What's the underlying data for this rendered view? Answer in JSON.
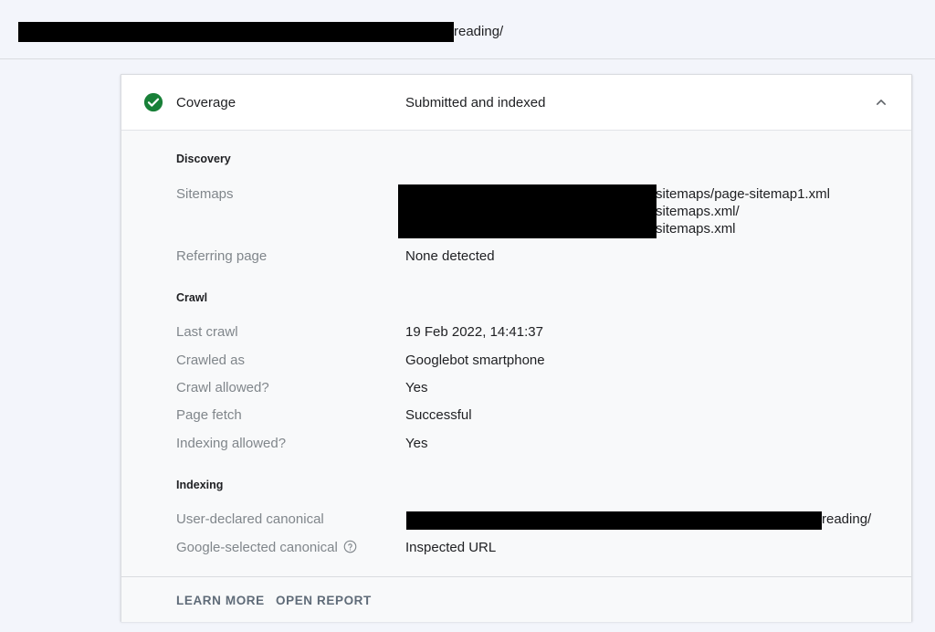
{
  "header": {
    "url_suffix": "reading/"
  },
  "coverage": {
    "title": "Coverage",
    "status": "Submitted and indexed",
    "status_color": "#188038",
    "icon": "check-circle-icon",
    "collapse_icon": "chevron-up-icon"
  },
  "discovery": {
    "section_title": "Discovery",
    "sitemaps_label": "Sitemaps",
    "sitemaps": [
      "sitemaps/page-sitemap1.xml",
      "sitemaps.xml/",
      "sitemaps.xml"
    ],
    "referring_label": "Referring page",
    "referring_value": "None detected"
  },
  "crawl": {
    "section_title": "Crawl",
    "rows": [
      {
        "label": "Last crawl",
        "value": "19 Feb 2022, 14:41:37"
      },
      {
        "label": "Crawled as",
        "value": "Googlebot smartphone"
      },
      {
        "label": "Crawl allowed?",
        "value": "Yes"
      },
      {
        "label": "Page fetch",
        "value": "Successful"
      },
      {
        "label": "Indexing allowed?",
        "value": "Yes"
      }
    ]
  },
  "indexing": {
    "section_title": "Indexing",
    "user_canonical_label": "User-declared canonical",
    "user_canonical_suffix": "reading/",
    "google_canonical_label": "Google-selected canonical",
    "google_canonical_value": "Inspected URL",
    "help_icon": "help-circle-icon"
  },
  "footer": {
    "learn_more": "LEARN MORE",
    "open_report": "OPEN REPORT"
  }
}
